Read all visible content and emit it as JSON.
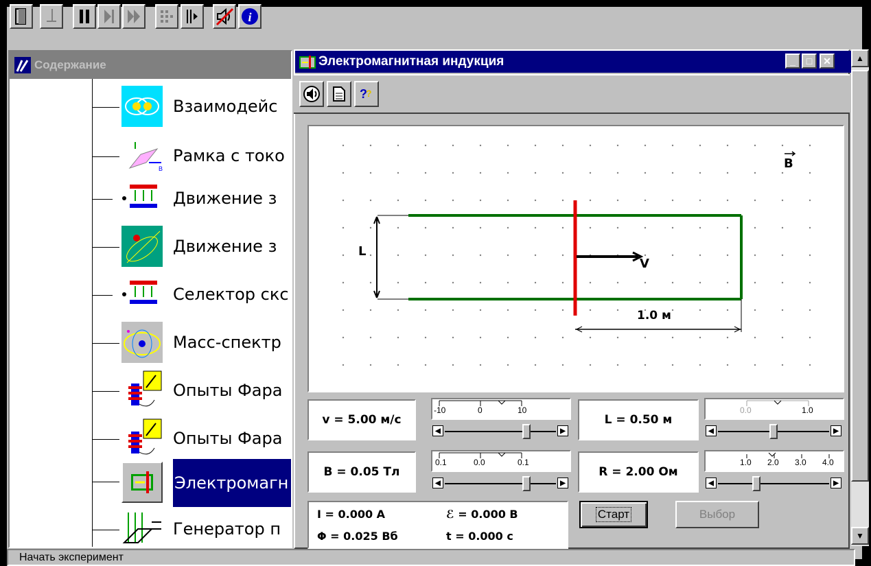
{
  "toolbar": {
    "buttons": [
      {
        "icon": "exit-icon"
      },
      {
        "icon": "step-icon"
      },
      {
        "icon": "pause-icon"
      },
      {
        "icon": "step-forward-icon"
      },
      {
        "icon": "fast-forward-icon"
      },
      {
        "icon": "grid-icon"
      },
      {
        "icon": "step-grid-icon"
      },
      {
        "icon": "sound-off-icon"
      },
      {
        "icon": "info-icon"
      }
    ]
  },
  "contents": {
    "title": "Содержание",
    "items": [
      {
        "label": "Взаимодейс"
      },
      {
        "label": "Рамка с токо"
      },
      {
        "label": "Движение з"
      },
      {
        "label": "Движение з"
      },
      {
        "label": "Селектор скс"
      },
      {
        "label": "Масс-спектр"
      },
      {
        "label": "Опыты Фара"
      },
      {
        "label": "Опыты Фара"
      },
      {
        "label": "Электромагн",
        "selected": true
      },
      {
        "label": "Генератор п"
      }
    ]
  },
  "window": {
    "title": "Электромагнитная индукция",
    "minimize": "_",
    "maximize": "□",
    "close": "✕",
    "tool_icons": [
      "sound-icon",
      "document-icon",
      "help-icon"
    ]
  },
  "simulation": {
    "field_label": "B",
    "length_label": "L",
    "velocity_label": "V",
    "distance_label": "1.0 м",
    "colors": {
      "rail": "#007000",
      "rod": "#e00000",
      "selection": "#000080"
    }
  },
  "controls": {
    "v": {
      "label": "v = 5.00 м/с",
      "ticks": [
        "-10",
        "0",
        "10"
      ],
      "level": 0.75
    },
    "L": {
      "label": "L = 0.50 м",
      "ticks": [
        "0.0",
        "1.0"
      ],
      "level": 0.5
    },
    "B": {
      "label": "B = 0.05 Тл",
      "ticks": [
        "0.1",
        "0.0",
        "0.1"
      ],
      "level": 0.75
    },
    "R": {
      "label": "R = 2.00 Ом",
      "ticks": [
        "1.0",
        "2.0",
        "3.0",
        "4.0"
      ],
      "level": 0.33
    }
  },
  "readouts": {
    "I": "I = 0.000 A",
    "E": "ℰ = 0.000 B",
    "Phi": "Φ = 0.025 Вб",
    "t": "t = 0.000 c"
  },
  "buttons": {
    "start": "Старт",
    "select": "Выбор"
  },
  "status": "Начать эксперимент"
}
